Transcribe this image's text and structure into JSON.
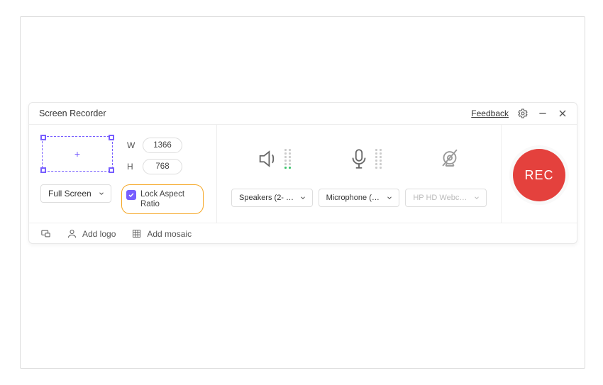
{
  "header": {
    "title": "Screen Recorder",
    "feedback": "Feedback"
  },
  "capture": {
    "width_label": "W",
    "height_label": "H",
    "width": "1366",
    "height": "768",
    "mode": "Full Screen",
    "lock_label": "Lock Aspect Ratio",
    "lock_checked": true
  },
  "devices": {
    "speaker": "Speakers (2- H…",
    "microphone": "Microphone (2…",
    "webcam": "HP HD Webca…"
  },
  "record": {
    "label": "REC"
  },
  "footer": {
    "add_logo": "Add logo",
    "add_mosaic": "Add mosaic"
  }
}
